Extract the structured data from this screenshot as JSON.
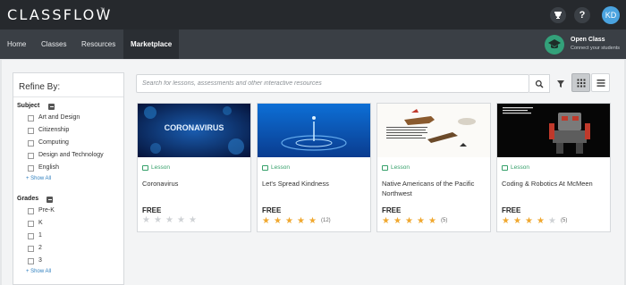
{
  "header": {
    "logo": "CLASSFLOW",
    "logo_mark": "™",
    "avatar_initials": "KD",
    "icons": [
      "trophy-icon",
      "help-icon"
    ]
  },
  "nav": {
    "items": [
      {
        "label": "Home"
      },
      {
        "label": "Classes"
      },
      {
        "label": "Resources"
      },
      {
        "label": "Marketplace"
      }
    ],
    "active": "Marketplace",
    "open_class": {
      "title": "Open Class",
      "subtitle": "Connect your students"
    }
  },
  "sidebar": {
    "title": "Refine By:",
    "subject": {
      "heading": "Subject",
      "options": [
        "Art and Design",
        "Citizenship",
        "Computing",
        "Design and Technology",
        "English"
      ],
      "show_all": "+ Show All"
    },
    "grades": {
      "heading": "Grades",
      "options": [
        "Pre-K",
        "K",
        "1",
        "2",
        "3"
      ],
      "show_all": "+ Show All"
    }
  },
  "search": {
    "placeholder": "Search for lessons, assessments and other interactive resources",
    "value": ""
  },
  "view": {
    "mode": "grid"
  },
  "colors": {
    "accent_green": "#35a06a",
    "star": "#f0a830",
    "link": "#2f7fbf",
    "topbar": "#26292d"
  },
  "cards": [
    {
      "type": "Lesson",
      "title": "Coronavirus",
      "price": "FREE",
      "rating": 0,
      "count": "",
      "thumb_text": "CORONAVIRUS"
    },
    {
      "type": "Lesson",
      "title": "Let's Spread Kindness",
      "price": "FREE",
      "rating": 5,
      "count": "(12)",
      "thumb_text": ""
    },
    {
      "type": "Lesson",
      "title": "Native Americans of the Pacific Northwest",
      "price": "FREE",
      "rating": 5,
      "count": "(5)",
      "thumb_text": ""
    },
    {
      "type": "Lesson",
      "title": "Coding & Robotics At McMeen",
      "price": "FREE",
      "rating": 4,
      "count": "(5)",
      "thumb_text": ""
    }
  ]
}
